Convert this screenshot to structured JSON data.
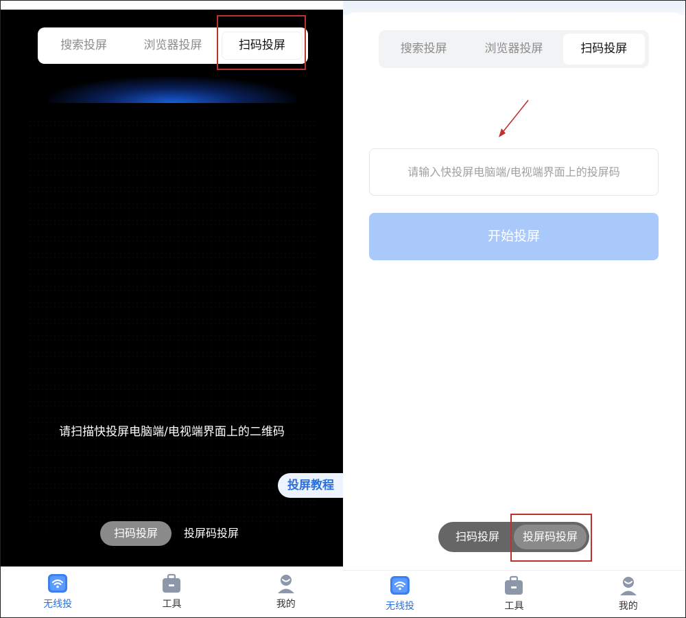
{
  "left": {
    "tabs": [
      {
        "label": "搜索投屏"
      },
      {
        "label": "浏览器投屏"
      },
      {
        "label": "扫码投屏"
      }
    ],
    "scan_hint": "请扫描快投屏电脑端/电视端界面上的二维码",
    "tutorial_label": "投屏教程",
    "mode_options": [
      {
        "label": "扫码投屏"
      },
      {
        "label": "投屏码投屏"
      }
    ],
    "nav": [
      {
        "label": "无线投"
      },
      {
        "label": "工具"
      },
      {
        "label": "我的"
      }
    ]
  },
  "right": {
    "tabs": [
      {
        "label": "搜索投屏"
      },
      {
        "label": "浏览器投屏"
      },
      {
        "label": "扫码投屏"
      }
    ],
    "code_input": {
      "value": "",
      "placeholder": "请输入快投屏电脑端/电视端界面上的投屏码"
    },
    "start_label": "开始投屏",
    "mode_options": [
      {
        "label": "扫码投屏"
      },
      {
        "label": "投屏码投屏"
      }
    ],
    "nav": [
      {
        "label": "无线投"
      },
      {
        "label": "工具"
      },
      {
        "label": "我的"
      }
    ]
  },
  "colors": {
    "accent": "#2b6fdc",
    "disabled_button": "#a9c9fb",
    "highlight_box": "#c0312b"
  }
}
